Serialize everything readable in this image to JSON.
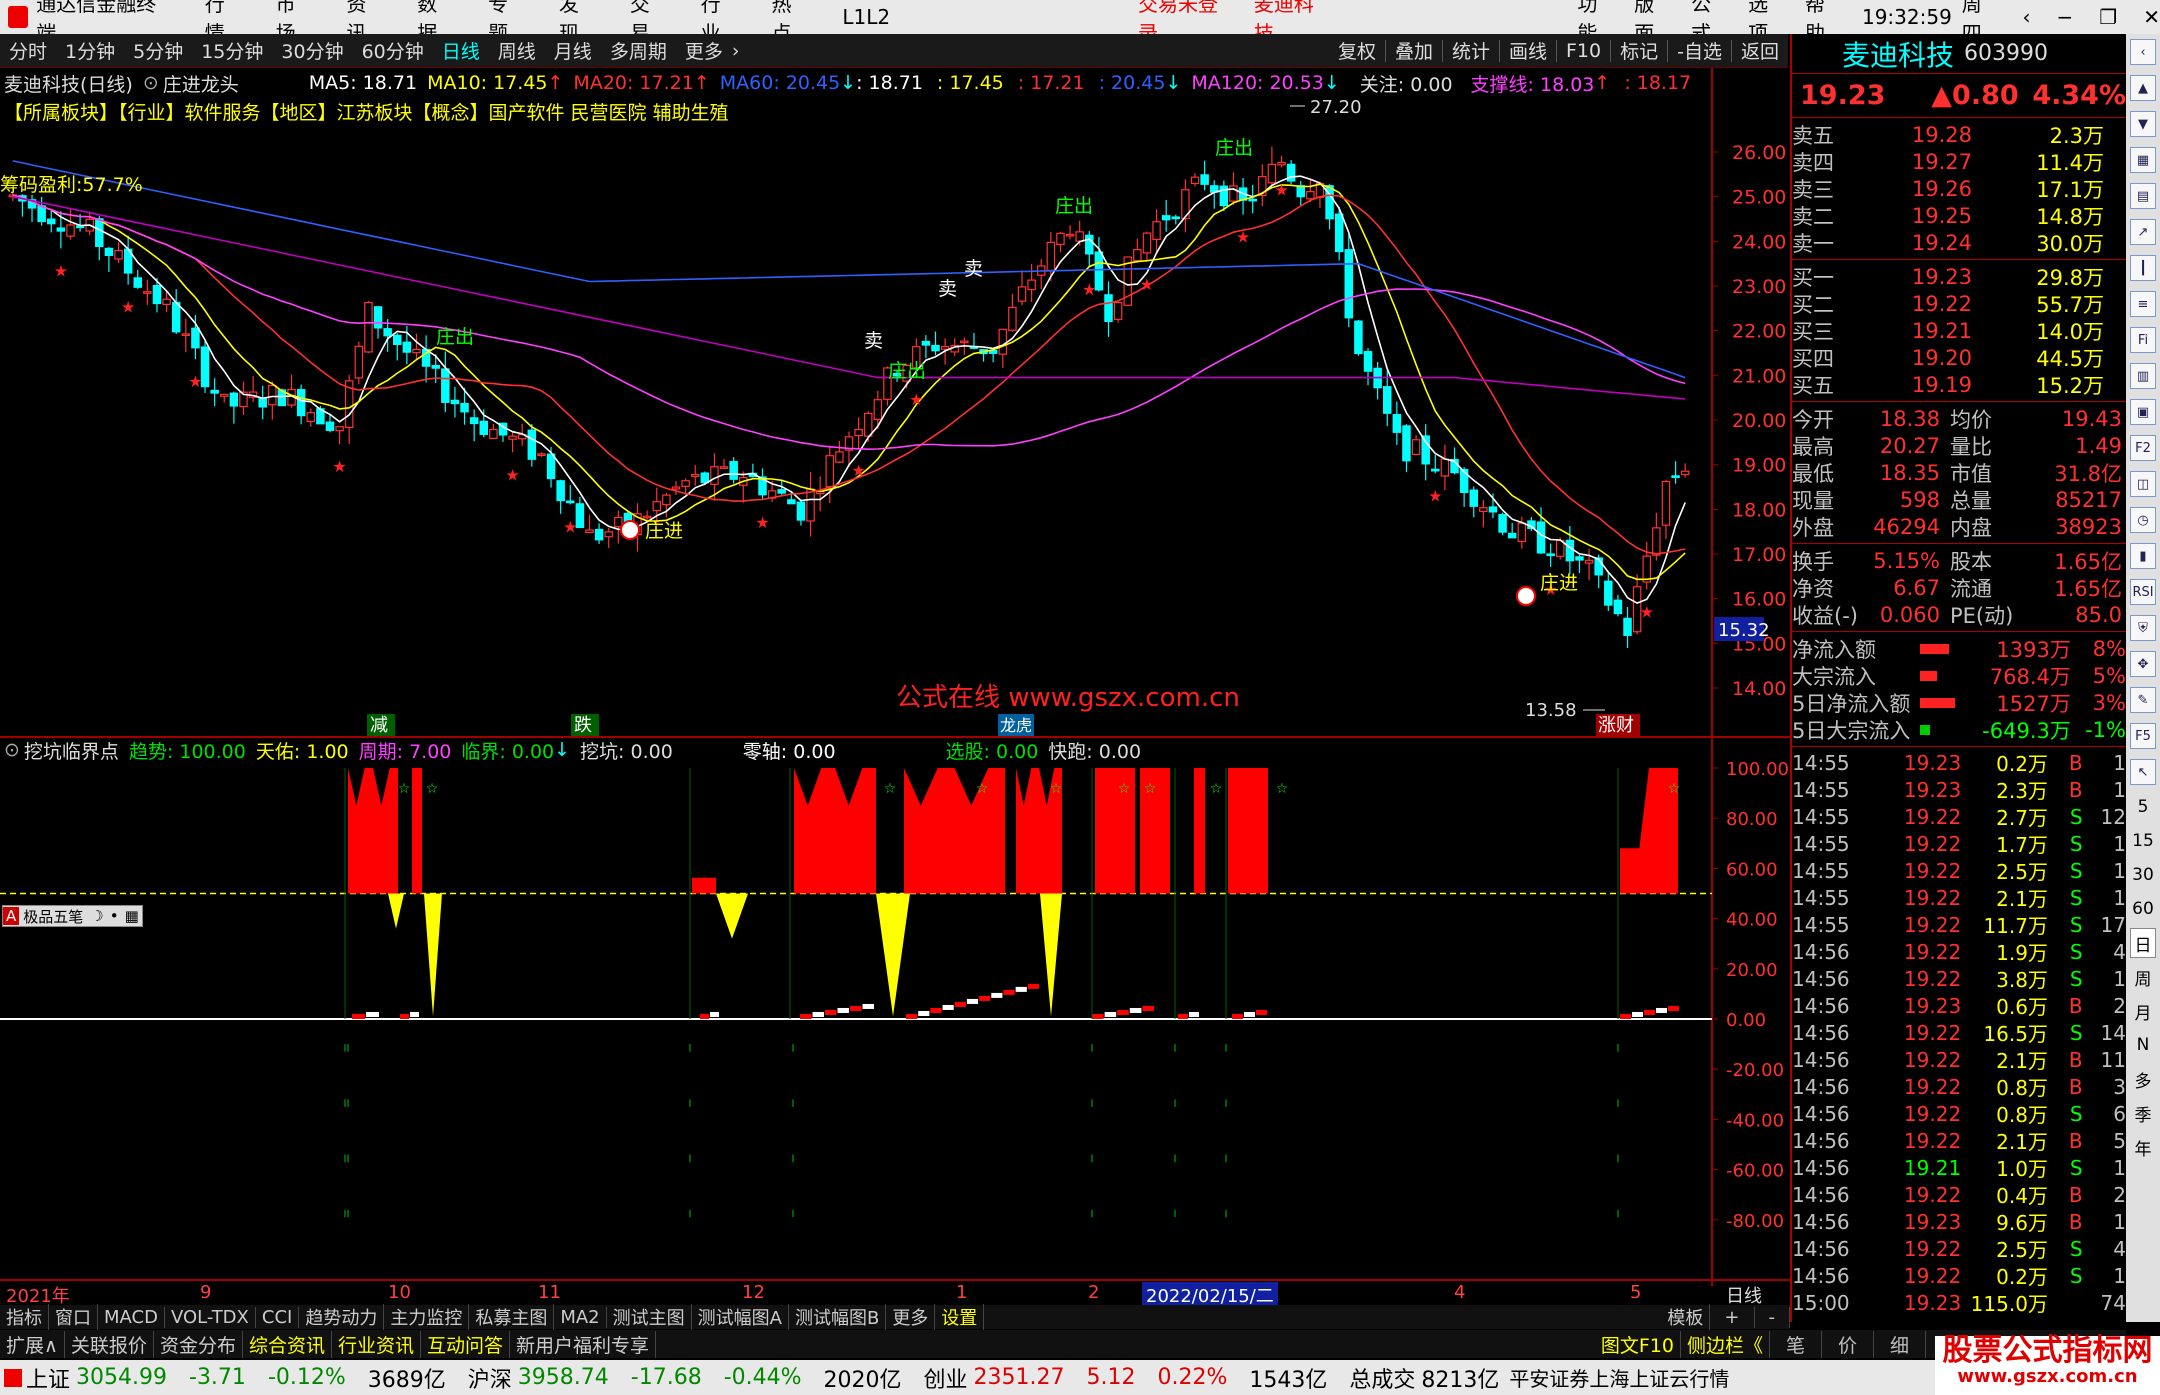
{
  "titlebar": {
    "app_name": "通达信金融终端",
    "menu": [
      "行情",
      "市场",
      "资讯",
      "数据",
      "专题",
      "发现",
      "交易",
      "行业",
      "热点",
      "L1L2"
    ],
    "login_status": "交易未登录",
    "stock_name": "麦迪科技",
    "right_menu": [
      "功能",
      "版面",
      "公式",
      "选项",
      "帮助"
    ],
    "time": "19:32:59",
    "weekday": "周四"
  },
  "toolbar": {
    "periods": [
      "分时",
      "1分钟",
      "5分钟",
      "15分钟",
      "30分钟",
      "60分钟",
      "日线",
      "周线",
      "月线",
      "多周期",
      "更多"
    ],
    "active_period": "日线",
    "right_buttons": [
      "复权",
      "叠加",
      "统计",
      "画线",
      "F10",
      "标记",
      "-自选",
      "返回"
    ]
  },
  "chart_header": {
    "title": "麦迪科技(日线)",
    "indicator": "庄进龙头",
    "ma5": "MA5: 18.71",
    "ma10": "MA10: 17.45",
    "ma20": "MA20: 17.21",
    "ma60": "MA60: 20.45",
    "v1": ": 18.71",
    "v2": ": 17.45",
    "v3": ": 17.21",
    "v4": ": 20.45",
    "ma120": "MA120: 20.53",
    "focus": "关注: 0.00",
    "support": "支撑线: 18.03",
    "v5": ": 18.17"
  },
  "sector_line": "【所属板块】【行业】软件服务【地区】江苏板块【概念】国产软件 民营医院 辅助生殖",
  "chip_profit": "筹码盈利:57.7%",
  "price_axis": [
    "26.00",
    "25.00",
    "24.00",
    "23.00",
    "22.00",
    "21.00",
    "20.00",
    "19.00",
    "18.00",
    "17.00",
    "16.00",
    "15.00",
    "14.00"
  ],
  "current_price_tag": "15.32",
  "max_label": "27.20",
  "min_label": "13.58",
  "annotations": {
    "zhuangjin1": "庄进",
    "zhuangjin2": "庄进",
    "zhuangchu": "庄出",
    "sell": "卖",
    "label_jian": "减",
    "label_die": "跌",
    "label_bang": "龙虎",
    "label_zhangcai": "涨财"
  },
  "watermark": "公式在线 www.gszx.com.cn",
  "lower_header": {
    "name": "挖坑临界点",
    "trend": "趋势: 100.00",
    "tianyou": "天佑: 1.00",
    "zhouqi": "周期: 7.00",
    "linjie": "临界: 0.00",
    "wakeng": "挖坑: 0.00",
    "lingzhou": "零轴: 0.00",
    "xuangu": "选股: 0.00",
    "kuaipao": "快跑: 0.00"
  },
  "lower_axis": [
    "100.00",
    "80.00",
    "60.00",
    "40.00",
    "20.00",
    "0.00",
    "-20.00",
    "-40.00",
    "-60.00",
    "-80.00"
  ],
  "mini_toolbar": "极品五笔",
  "date_axis": [
    "2021年",
    "9",
    "10",
    "11",
    "12",
    "1",
    "2",
    "2022/02/15/二",
    "4",
    "5"
  ],
  "date_axis_right": "日线",
  "bottom_tabs": [
    "指标",
    "窗口",
    "MACD",
    "VOL-TDX",
    "CCI",
    "趋势动力",
    "主力监控",
    "私募主图",
    "MA2",
    "测试主图",
    "测试幅图A",
    "测试幅图B",
    "更多",
    "设置"
  ],
  "bottom_tabs_right": [
    "模板",
    "+",
    "-"
  ],
  "bottom_tabs2": [
    "扩展∧",
    "关联报价",
    "资金分布",
    "综合资讯",
    "行业资讯",
    "互动问答",
    "新用户福利专享"
  ],
  "bottom_tabs2_right": [
    "图文F10",
    "侧边栏《",
    "笔",
    "价",
    "细"
  ],
  "quote": {
    "name": "麦迪科技",
    "code": "603990",
    "price": "19.23",
    "change": "▲0.80",
    "pct": "4.34%",
    "asks": [
      {
        "label": "卖五",
        "price": "19.28",
        "vol": "2.3万"
      },
      {
        "label": "卖四",
        "price": "19.27",
        "vol": "11.4万"
      },
      {
        "label": "卖三",
        "price": "19.26",
        "vol": "17.1万"
      },
      {
        "label": "卖二",
        "price": "19.25",
        "vol": "14.8万"
      },
      {
        "label": "卖一",
        "price": "19.24",
        "vol": "30.0万"
      }
    ],
    "bids": [
      {
        "label": "买一",
        "price": "19.23",
        "vol": "29.8万"
      },
      {
        "label": "买二",
        "price": "19.22",
        "vol": "55.7万"
      },
      {
        "label": "买三",
        "price": "19.21",
        "vol": "14.0万"
      },
      {
        "label": "买四",
        "price": "19.20",
        "vol": "44.5万"
      },
      {
        "label": "买五",
        "price": "19.19",
        "vol": "15.2万"
      }
    ],
    "stats": [
      {
        "k1": "今开",
        "v1": "18.38",
        "k2": "均价",
        "v2": "19.43"
      },
      {
        "k1": "最高",
        "v1": "20.27",
        "k2": "量比",
        "v2": "1.49"
      },
      {
        "k1": "最低",
        "v1": "18.35",
        "k2": "市值",
        "v2": "31.8亿"
      },
      {
        "k1": "现量",
        "v1": "598",
        "k2": "总量",
        "v2": "85217"
      },
      {
        "k1": "外盘",
        "v1": "46294",
        "k2": "内盘",
        "v2": "38923"
      }
    ],
    "stats2": [
      {
        "k1": "换手",
        "v1": "5.15%",
        "k2": "股本",
        "v2": "1.65亿"
      },
      {
        "k1": "净资",
        "v1": "6.67",
        "k2": "流通",
        "v2": "1.65亿"
      },
      {
        "k1": "收益(-)",
        "v1": "0.060",
        "k2": "PE(动)",
        "v2": "85.0"
      }
    ],
    "flows": [
      {
        "k": "净流入额",
        "v": "1393万",
        "p": "8%"
      },
      {
        "k": "大宗流入",
        "v": "768.4万",
        "p": "5%"
      },
      {
        "k": "5日净流入额",
        "v": "1527万",
        "p": "3%"
      },
      {
        "k": "5日大宗流入",
        "v": "-649.3万",
        "p": "-1%"
      }
    ],
    "ticks": [
      [
        "14:55",
        "19.23",
        "0.2万",
        "B",
        "1"
      ],
      [
        "14:55",
        "19.23",
        "2.3万",
        "B",
        "1"
      ],
      [
        "14:55",
        "19.22",
        "2.7万",
        "S",
        "12"
      ],
      [
        "14:55",
        "19.22",
        "1.7万",
        "S",
        "1"
      ],
      [
        "14:55",
        "19.22",
        "2.5万",
        "S",
        "1"
      ],
      [
        "14:55",
        "19.22",
        "2.1万",
        "S",
        "1"
      ],
      [
        "14:55",
        "19.22",
        "11.7万",
        "S",
        "17"
      ],
      [
        "14:56",
        "19.22",
        "1.9万",
        "S",
        "4"
      ],
      [
        "14:56",
        "19.22",
        "3.8万",
        "S",
        "1"
      ],
      [
        "14:56",
        "19.23",
        "0.6万",
        "B",
        "2"
      ],
      [
        "14:56",
        "19.22",
        "16.5万",
        "S",
        "14"
      ],
      [
        "14:56",
        "19.22",
        "2.1万",
        "B",
        "11"
      ],
      [
        "14:56",
        "19.22",
        "0.8万",
        "B",
        "3"
      ],
      [
        "14:56",
        "19.22",
        "0.8万",
        "S",
        "6"
      ],
      [
        "14:56",
        "19.22",
        "2.1万",
        "B",
        "5"
      ],
      [
        "14:56",
        "19.21",
        "1.0万",
        "S",
        "1"
      ],
      [
        "14:56",
        "19.22",
        "0.4万",
        "B",
        "2"
      ],
      [
        "14:56",
        "19.23",
        "9.6万",
        "B",
        "1"
      ],
      [
        "14:56",
        "19.22",
        "2.5万",
        "S",
        "4"
      ],
      [
        "14:56",
        "19.22",
        "0.2万",
        "S",
        "1"
      ],
      [
        "15:00",
        "19.23",
        "115.0万",
        "",
        "74"
      ]
    ]
  },
  "side_labels": [
    "5",
    "15",
    "30",
    "60",
    "日",
    "周",
    "月",
    "N",
    "多",
    "季",
    "年"
  ],
  "status": {
    "sh_name": "上证",
    "sh_val": "3054.99",
    "sh_chg": "-3.71",
    "sh_pct": "-0.12%",
    "sh_amt": "3689亿",
    "sz_name": "沪深",
    "sz_val": "3958.74",
    "sz_chg": "-17.68",
    "sz_pct": "-0.44%",
    "sz_amt": "2020亿",
    "cy_name": "创业",
    "cy_val": "2351.27",
    "cy_chg": "5.12",
    "cy_pct": "0.22%",
    "cy_amt": "1543亿",
    "total_label": "总成交",
    "total_val": "8213亿",
    "broker": "平安证券上海上证云行情"
  },
  "logo": {
    "line1": "股票公式指标网",
    "line2": "www.gszx.com.cn"
  },
  "chart_data": {
    "type": "candlestick",
    "ylim": [
      13,
      27.5
    ],
    "price_levels": [
      26,
      25,
      24,
      23,
      22,
      21,
      20,
      19,
      18,
      17,
      16,
      15,
      14
    ],
    "max": 27.2,
    "min": 13.58,
    "last": 19.23,
    "indicator_ylim": [
      -90,
      105
    ],
    "indicator_levels": [
      100,
      80,
      60,
      40,
      20,
      0,
      -20,
      -40,
      -60,
      -80
    ]
  },
  "colors": {
    "up": "#ff3232",
    "down": "#00ffff",
    "ma5": "#ffffff",
    "ma10": "#ffff00",
    "ma20": "#ff40ff",
    "ma60": "#3060ff",
    "ma120": "#c000c0",
    "border": "#a00000"
  }
}
